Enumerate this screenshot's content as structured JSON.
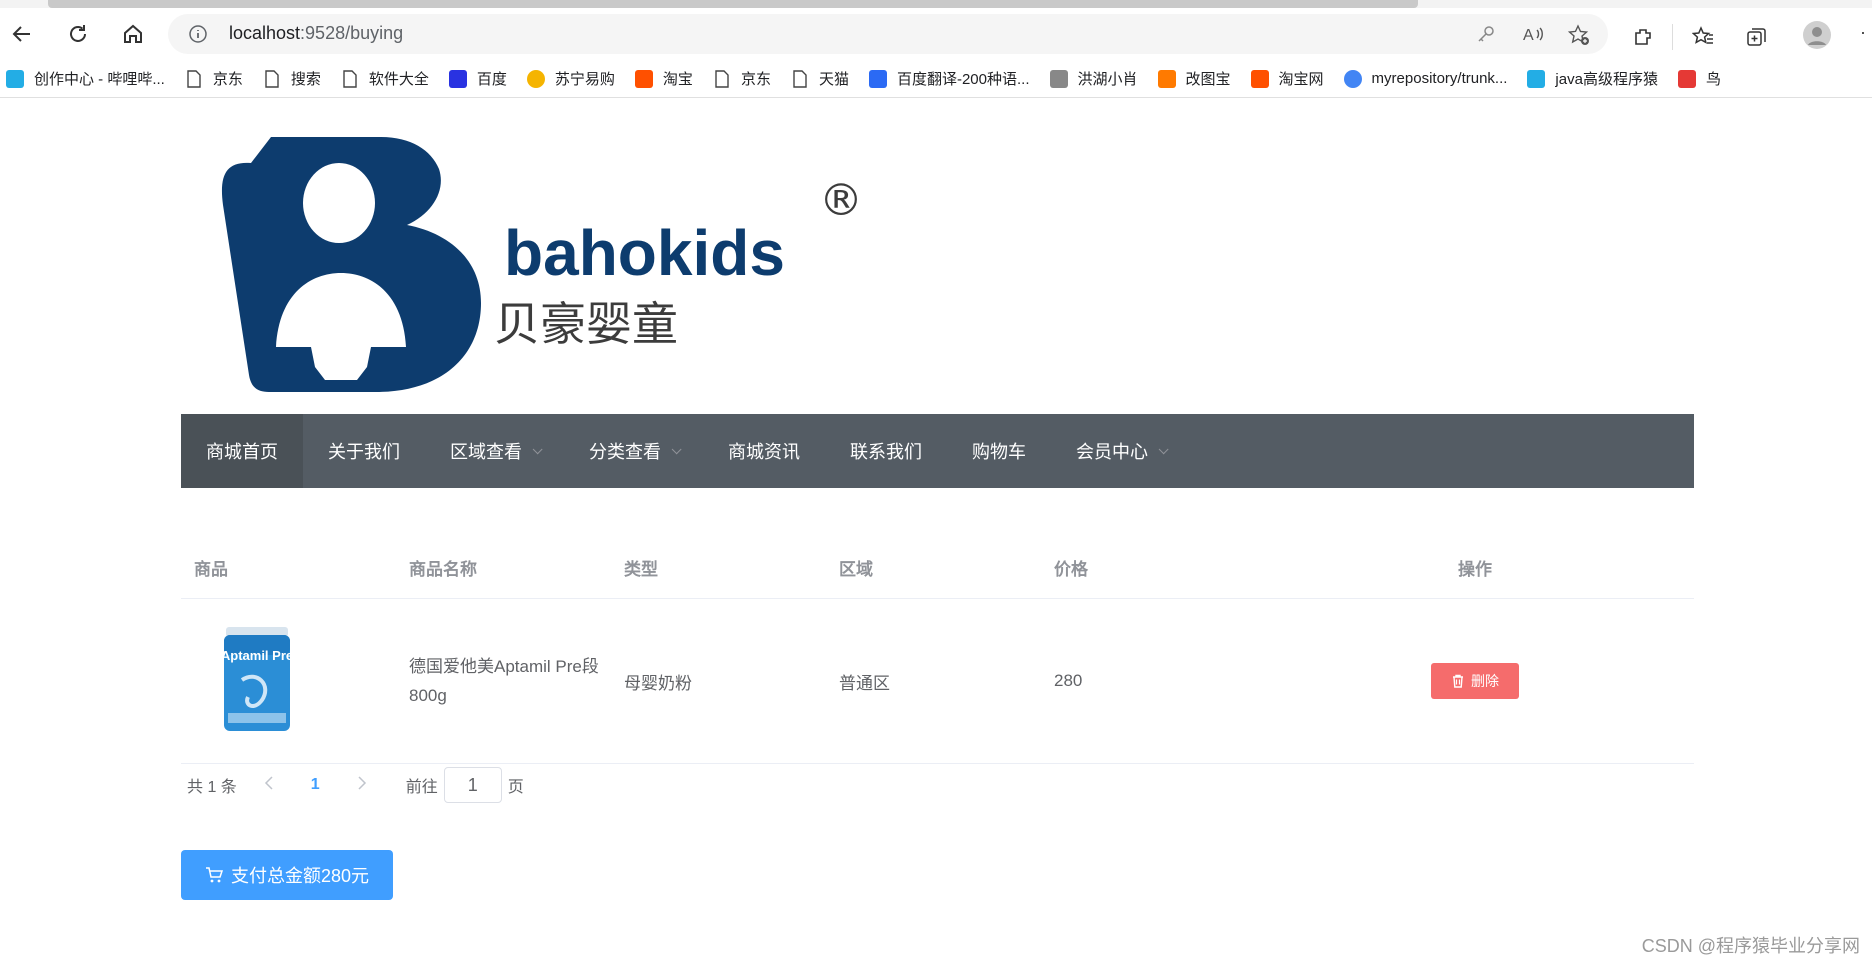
{
  "browser": {
    "url_host": "localhost",
    "url_path": ":9528/buying",
    "bookmarks": [
      {
        "label": "创作中心 - 哔哩哔...",
        "icon": "bilibili-icon",
        "color": "#23ade5"
      },
      {
        "label": "京东",
        "icon": "page-icon",
        "color": ""
      },
      {
        "label": "搜索",
        "icon": "page-icon",
        "color": ""
      },
      {
        "label": "软件大全",
        "icon": "page-icon",
        "color": ""
      },
      {
        "label": "百度",
        "icon": "baidu-icon",
        "color": "#2932e1"
      },
      {
        "label": "苏宁易购",
        "icon": "suning-icon",
        "color": "#f5b400"
      },
      {
        "label": "淘宝",
        "icon": "taobao-icon",
        "color": "#ff5000"
      },
      {
        "label": "京东",
        "icon": "page-icon",
        "color": ""
      },
      {
        "label": "天猫",
        "icon": "page-icon",
        "color": ""
      },
      {
        "label": "百度翻译-200种语...",
        "icon": "translate-icon",
        "color": "#2b6af4"
      },
      {
        "label": "洪湖小肖",
        "icon": "bird-icon",
        "color": "#888888"
      },
      {
        "label": "改图宝",
        "icon": "gaitubao-icon",
        "color": "#ff7a00"
      },
      {
        "label": "淘宝网",
        "icon": "taobao-icon",
        "color": "#ff5000"
      },
      {
        "label": "myrepository/trunk...",
        "icon": "chrome-icon",
        "color": "#4285f4"
      },
      {
        "label": "java高级程序猿",
        "icon": "bilibili-icon",
        "color": "#23ade5"
      },
      {
        "label": "鸟",
        "icon": "bird-red-icon",
        "color": "#e53935"
      }
    ]
  },
  "logo": {
    "brand_en": "bahokids",
    "brand_cn": "贝豪婴童",
    "registered": "®"
  },
  "menu": {
    "items": [
      {
        "label": "商城首页",
        "dropdown": false,
        "active": true
      },
      {
        "label": "关于我们",
        "dropdown": false,
        "active": false
      },
      {
        "label": "区域查看",
        "dropdown": true,
        "active": false
      },
      {
        "label": "分类查看",
        "dropdown": true,
        "active": false
      },
      {
        "label": "商城资讯",
        "dropdown": false,
        "active": false
      },
      {
        "label": "联系我们",
        "dropdown": false,
        "active": false
      },
      {
        "label": "购物车",
        "dropdown": false,
        "active": false
      },
      {
        "label": "会员中心",
        "dropdown": true,
        "active": false
      }
    ],
    "bg_color": "#545c64"
  },
  "table": {
    "headers": [
      "商品",
      "商品名称",
      "类型",
      "区域",
      "价格",
      "操作"
    ],
    "rows": [
      {
        "image": "Aptamil Pre",
        "name": "德国爱他美Aptamil Pre段 800g",
        "type": "母婴奶粉",
        "area": "普通区",
        "price": "280",
        "action": "删除"
      }
    ]
  },
  "pagination": {
    "total": "共 1 条",
    "current": "1",
    "goto_label": "前往",
    "goto_value": "1",
    "page_suffix": "页"
  },
  "pay_button": "支付总金额280元",
  "watermark": "CSDN @程序猿毕业分享网",
  "colors": {
    "primary": "#409eff",
    "danger": "#f56c6c",
    "logo_blue": "#0d3c6e"
  }
}
